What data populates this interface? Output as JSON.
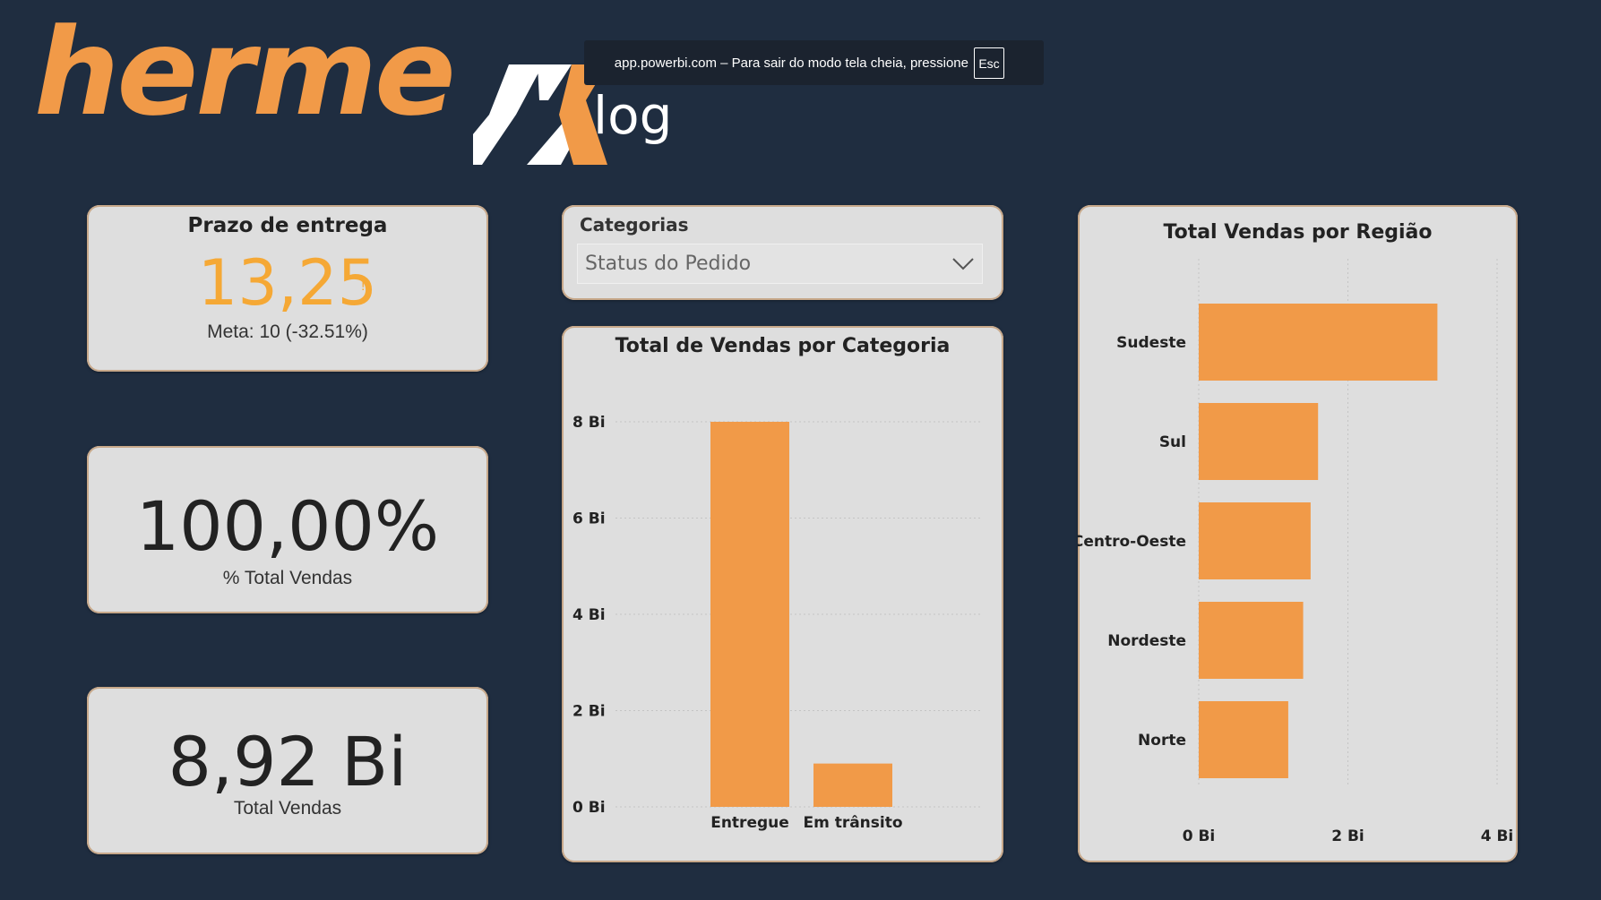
{
  "brand": {
    "name_part": "herme",
    "sub": "log",
    "orange": "#f19a48",
    "white": "#ffffff"
  },
  "fullscreen_banner": {
    "message": "app.powerbi.com – Para sair do modo tela cheia, pressione",
    "key": "Esc"
  },
  "kpis": {
    "delivery": {
      "title": "Prazo de entrega",
      "value": "13,25",
      "indicator": "!",
      "goal": "Meta: 10 (-32.51%)",
      "value_color": "#f5a835"
    },
    "pct_sales": {
      "value": "100,00%",
      "label": "% Total Vendas"
    },
    "total_sales": {
      "value": "8,92 Bi",
      "label": "Total Vendas"
    }
  },
  "slicer": {
    "label": "Categorias",
    "selected": "Status do Pedido",
    "icon": "chevron-down-icon"
  },
  "chart_data": [
    {
      "type": "bar",
      "title": "Total de Vendas por Categoria",
      "categories": [
        "Entregue",
        "Em trânsito"
      ],
      "values": [
        8.0,
        0.9
      ],
      "ylim": [
        0,
        8
      ],
      "yticks": [
        "0 Bi",
        "2 Bi",
        "4 Bi",
        "6 Bi",
        "8 Bi"
      ],
      "grid": true,
      "bar_color": "#f19a48"
    },
    {
      "type": "bar",
      "orientation": "horizontal",
      "title": "Total Vendas por Região",
      "categories": [
        "Sudeste",
        "Sul",
        "Centro-Oeste",
        "Nordeste",
        "Norte"
      ],
      "values": [
        3.2,
        1.6,
        1.5,
        1.4,
        1.2
      ],
      "xlim": [
        0,
        4
      ],
      "xticks": [
        "0 Bi",
        "2 Bi",
        "4 Bi"
      ],
      "grid": true,
      "bar_color": "#f19a48"
    }
  ]
}
